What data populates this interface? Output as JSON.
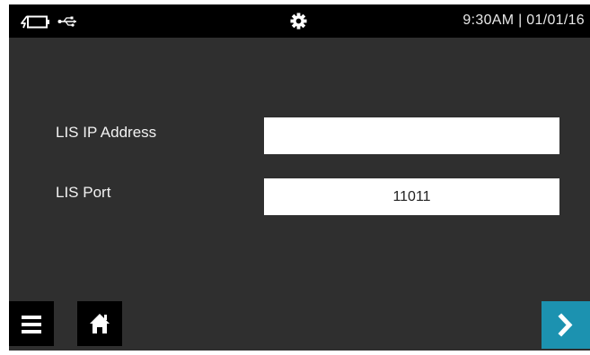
{
  "status_bar": {
    "icons": [
      "battery-charging-icon",
      "usb-icon",
      "gear-icon"
    ],
    "time": "9:30AM",
    "separator": "|",
    "date": "01/01/16",
    "clock_text": "9:30AM | 01/01/16"
  },
  "form": {
    "lis_ip": {
      "label": "LIS IP Address",
      "value": ""
    },
    "lis_port": {
      "label": "LIS Port",
      "value": "11011"
    }
  },
  "footer": {
    "menu_icon": "hamburger-menu-icon",
    "home_icon": "home-icon",
    "next_icon": "chevron-right-icon"
  },
  "colors": {
    "screen_background": "#2f2f2f",
    "status_bar": "#000000",
    "field_background": "#ffffff",
    "accent": "#1c92b0"
  }
}
